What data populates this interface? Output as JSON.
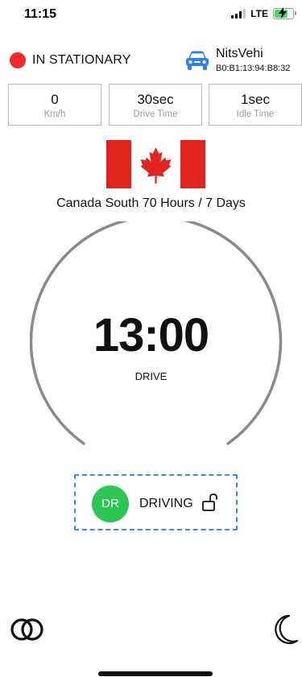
{
  "status_bar": {
    "time": "11:15",
    "network": "LTE",
    "battery_charging": true
  },
  "vehicle_state": {
    "label": "IN STATIONARY",
    "indicator_color": "#f02a2a"
  },
  "vehicle": {
    "name": "NitsVehi",
    "mac": "B0:B1:13:94:B8:32",
    "icon": "car-icon",
    "icon_color": "#2f7ff0"
  },
  "metrics": [
    {
      "value": "0",
      "label": "Km/h"
    },
    {
      "value": "30sec",
      "label": "Drive Time"
    },
    {
      "value": "1sec",
      "label": "Idle Time"
    }
  ],
  "ruleset": {
    "flag_icon": "canada-flag-icon",
    "text": "Canada South 70 Hours / 7 Days"
  },
  "clock": {
    "value": "13:00",
    "label": "DRIVE"
  },
  "duty_status": {
    "code": "DR",
    "label": "DRIVING",
    "avatar_color": "#2dc653",
    "lock_icon": "unlock-icon"
  },
  "bottom_bar": {
    "left_icon": "theme-toggle-icon",
    "right_icon": "night-mode-icon"
  }
}
